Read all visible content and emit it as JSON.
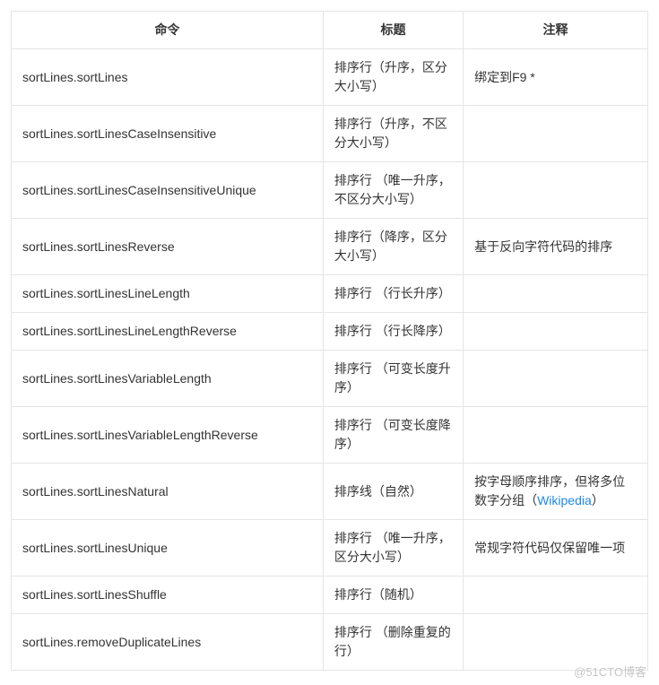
{
  "headers": {
    "cmd": "命令",
    "title": "标题",
    "note": "注释"
  },
  "rows": [
    {
      "cmd": "sortLines.sortLines",
      "title": "排序行（升序，区分大小写）",
      "note_plain": "绑定到F9 *"
    },
    {
      "cmd": "sortLines.sortLinesCaseInsensitive",
      "title": "排序行（升序，不区分大小写）",
      "note_plain": ""
    },
    {
      "cmd": "sortLines.sortLinesCaseInsensitiveUnique",
      "title": "排序行\n（唯一升序，不区分大小写）",
      "note_plain": ""
    },
    {
      "cmd": "sortLines.sortLinesReverse",
      "title": "排序行（降序，区分大小写）",
      "note_plain": "基于反向字符代码的排序"
    },
    {
      "cmd": "sortLines.sortLinesLineLength",
      "title": "排序行\n（行长升序）",
      "note_plain": ""
    },
    {
      "cmd": "sortLines.sortLinesLineLengthReverse",
      "title": "排序行\n（行长降序）",
      "note_plain": ""
    },
    {
      "cmd": "sortLines.sortLinesVariableLength",
      "title": "排序行\n（可变长度升序）",
      "note_plain": ""
    },
    {
      "cmd": "sortLines.sortLinesVariableLengthReverse",
      "title": "排序行\n（可变长度降序）",
      "note_plain": ""
    },
    {
      "cmd": "sortLines.sortLinesNatural",
      "title": "排序线（自然）",
      "note_pre": "按字母顺序排序，但将多位数字分组（",
      "note_link": "Wikipedia",
      "note_post": "）"
    },
    {
      "cmd": "sortLines.sortLinesUnique",
      "title": "排序行\n（唯一升序，区分大小写）",
      "note_plain": "常规字符代码仅保留唯一项"
    },
    {
      "cmd": "sortLines.sortLinesShuffle",
      "title": "排序行（随机）",
      "note_plain": ""
    },
    {
      "cmd": "sortLines.removeDuplicateLines",
      "title": "排序行\n（删除重复的行）",
      "note_plain": ""
    }
  ],
  "watermark": "@51CTO博客"
}
